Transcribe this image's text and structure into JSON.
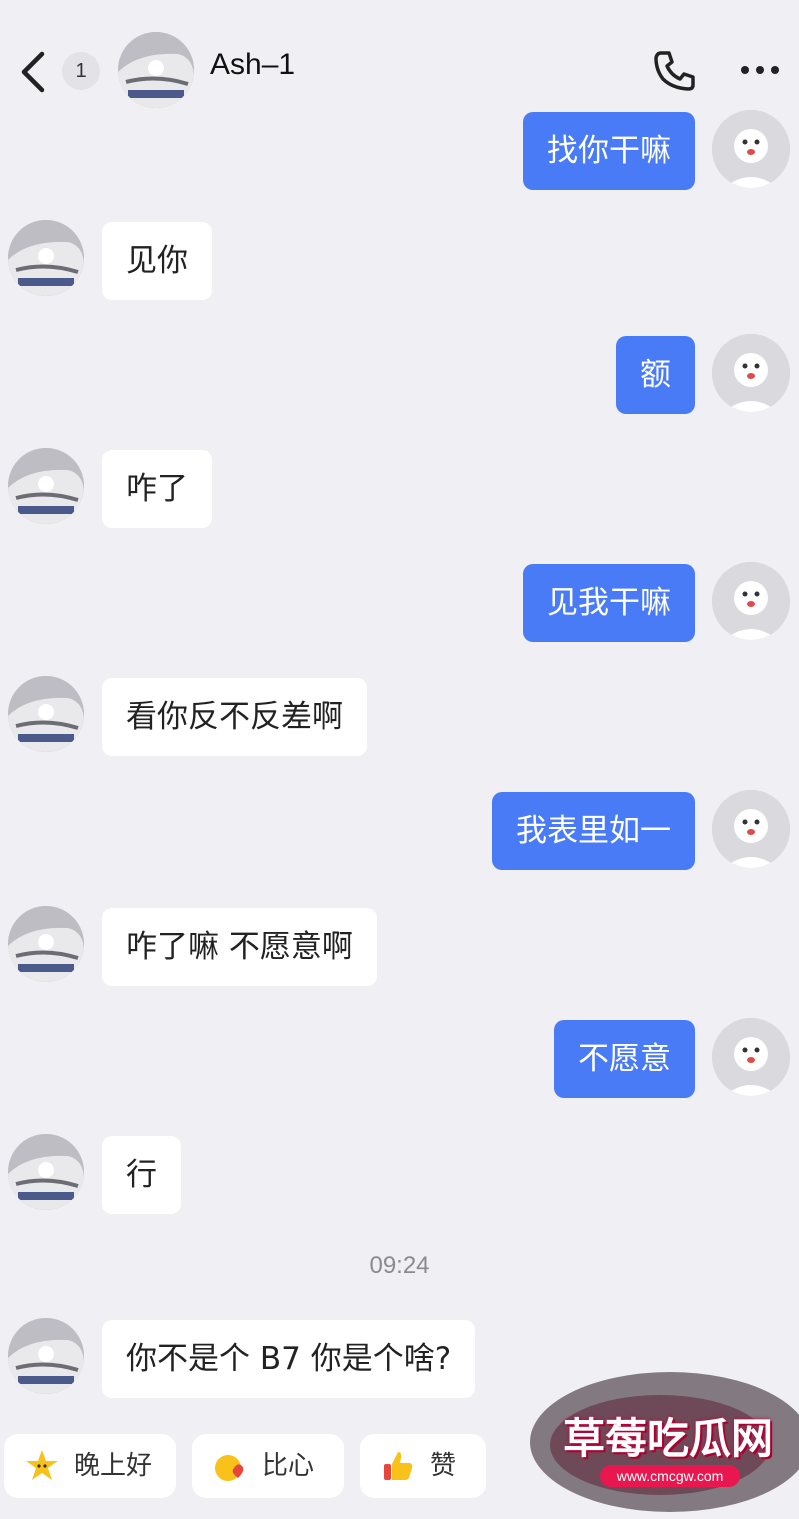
{
  "header": {
    "unread_count": "1",
    "contact_name": "Ash–1",
    "icons": [
      "back-arrow-icon",
      "phone-icon",
      "more-icon"
    ]
  },
  "messages": [
    {
      "side": "out",
      "text": "找你干嘛"
    },
    {
      "side": "in",
      "text": "见你"
    },
    {
      "side": "out",
      "text": "额"
    },
    {
      "side": "in",
      "text": "咋了"
    },
    {
      "side": "out",
      "text": "见我干嘛"
    },
    {
      "side": "in",
      "text": "看你反不反差啊"
    },
    {
      "side": "out",
      "text": "我表里如一"
    },
    {
      "side": "in",
      "text": "咋了嘛 不愿意啊"
    },
    {
      "side": "out",
      "text": "不愿意"
    },
    {
      "side": "in",
      "text": "行"
    },
    {
      "side": "in",
      "text": "你不是个 B7 你是个啥?"
    }
  ],
  "timestamp": "09:24",
  "quick_replies": [
    {
      "label": "晚上好",
      "icon": "star-face-icon"
    },
    {
      "label": "比心",
      "icon": "heart-hands-icon"
    },
    {
      "label": "赞",
      "icon": "thumbs-up-icon"
    }
  ],
  "watermark": {
    "title": "草莓吃瓜网",
    "url": "www.cmcgw.com"
  },
  "colors": {
    "background": "#efeff4",
    "outgoing_bubble": "#4a7bf7",
    "incoming_bubble": "#ffffff",
    "watermark": "#e8174f"
  }
}
